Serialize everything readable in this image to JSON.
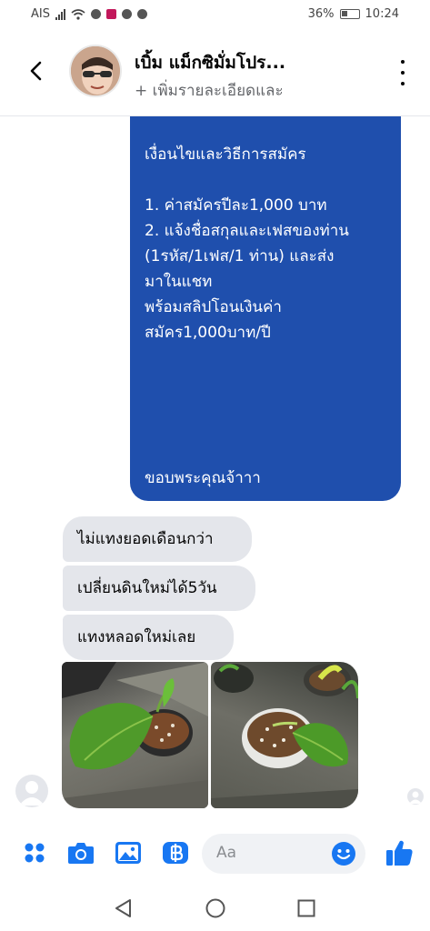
{
  "status_bar": {
    "carrier": "AIS",
    "battery": "36%",
    "time": "10:24"
  },
  "header": {
    "contact_name": "เบิ้ม แม็กซิมั่มโปร...",
    "subtitle": "+ เพิ่มรายละเอียดและ"
  },
  "messages": {
    "outgoing": {
      "lines": [
        "เงื่อนไขและวิธีการสมัคร",
        "1. ค่าสมัครปีละ1,000 บาท",
        "2. แจ้งชื่อสกุลและเฟสของท่าน",
        "(1รหัส/1เฟส/1 ท่าน) และส่ง",
        "มาในแชท",
        "พร้อมสลิปโอนเงินค่า",
        "สมัคร1,000บาท/ปี",
        "ขอบพระคุณจ้าาา"
      ]
    },
    "incoming": [
      "ไม่แทงยอดเดือนกว่า",
      "เปลี่ยนดินใหม่ได้5วัน",
      "แทงหลอดใหม่เลย"
    ]
  },
  "composer": {
    "placeholder": "Aa"
  },
  "colors": {
    "messenger_blue": "#1877f2",
    "outgoing_bubble": "#1f4fad",
    "incoming_bubble": "#e4e6eb"
  }
}
